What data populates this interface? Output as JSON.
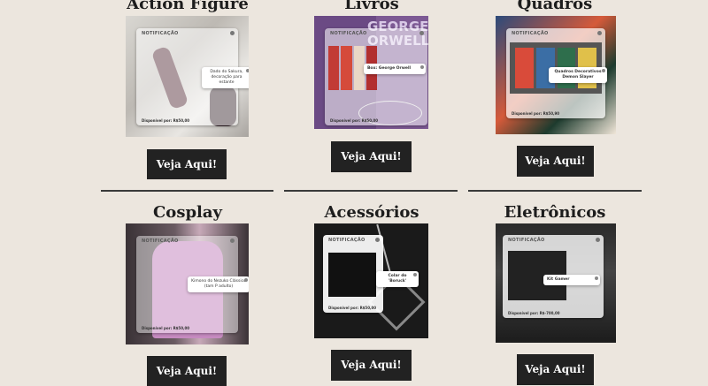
{
  "categories": [
    {
      "title": "Action Figure",
      "button": "Veja Aqui!",
      "card": {
        "header": "NOTIFICAÇÃO",
        "product": "Dado do Sakura, decoração para estante",
        "price": "Disponível por: R$50,00"
      }
    },
    {
      "title": "Livros",
      "button": "Veja Aqui!",
      "card": {
        "header": "NOTIFICAÇÃO",
        "product": "Box: George Orwell",
        "price": "Disponível por: R$50,00"
      }
    },
    {
      "title": "Quadros",
      "button": "Veja Aqui!",
      "card": {
        "header": "NOTIFICAÇÃO",
        "product": "Quadros Decorativos Demon Slayer",
        "price": "Disponível por: R$50,90"
      }
    },
    {
      "title": "Cosplay",
      "button": "Veja Aqui!",
      "card": {
        "header": "NOTIFICAÇÃO",
        "product": "Kimono do Nezuko Clássico (tam P adulto)",
        "price": "Disponível por: R$50,00"
      }
    },
    {
      "title": "Acessórios",
      "button": "Veja Aqui!",
      "card": {
        "header": "NOTIFICAÇÃO",
        "product": "Colar do 'Boruck'",
        "price": "Disponível por: R$50,00"
      }
    },
    {
      "title": "Eletrônicos",
      "button": "Veja Aqui!",
      "card": {
        "header": "NOTIFICAÇÃO",
        "product": "Kit Gamer",
        "price": "Disponível por: R$-700,00"
      }
    }
  ],
  "book_cover_text": "GEORGE ORWELL",
  "colors": {
    "background": "#ece6de",
    "button": "#222222",
    "button_text": "#ffffff",
    "title": "#1d1d1d"
  }
}
